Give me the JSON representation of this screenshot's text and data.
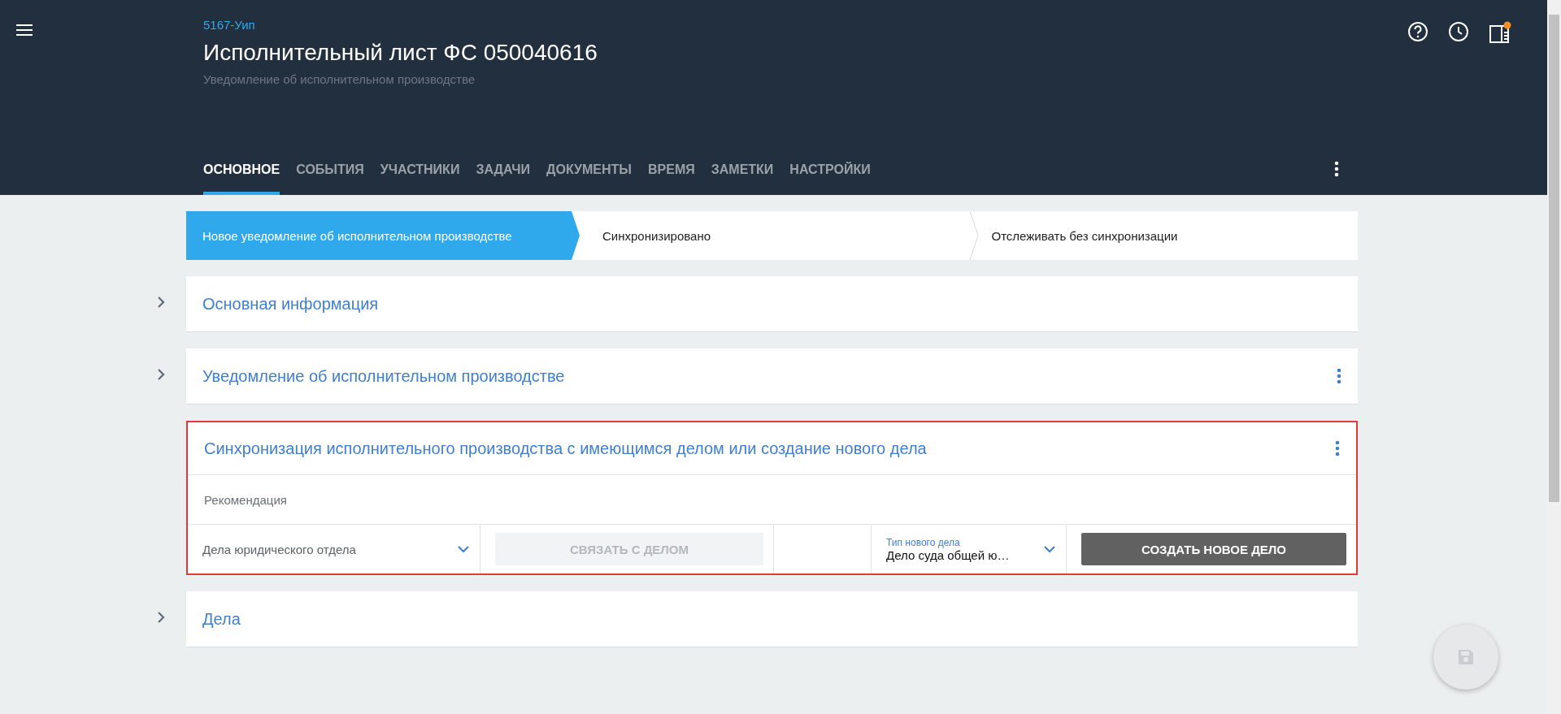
{
  "header": {
    "case_number": "5167-Уип",
    "title": "Исполнительный лист ФС 050040616",
    "subtitle": "Уведомление об исполнительном производстве",
    "panel_badge": true
  },
  "tabs": [
    {
      "label": "ОСНОВНОЕ",
      "selected": true
    },
    {
      "label": "СОБЫТИЯ",
      "selected": false
    },
    {
      "label": "УЧАСТНИКИ",
      "selected": false
    },
    {
      "label": "ЗАДАЧИ",
      "selected": false
    },
    {
      "label": "ДОКУМЕНТЫ",
      "selected": false
    },
    {
      "label": "ВРЕМЯ",
      "selected": false
    },
    {
      "label": "ЗАМЕТКИ",
      "selected": false
    },
    {
      "label": "НАСТРОЙКИ",
      "selected": false
    }
  ],
  "stepper": [
    {
      "label": "Новое уведомление об исполнительном производстве",
      "selected": true
    },
    {
      "label": "Синхронизировано",
      "selected": false
    },
    {
      "label": "Отслеживать без синхронизации",
      "selected": false
    }
  ],
  "sections": [
    {
      "title": "Основная информация",
      "expanded": false,
      "has_menu": false,
      "highlighted": false
    },
    {
      "title": "Уведомление об исполнительном производстве",
      "expanded": false,
      "has_menu": true,
      "highlighted": false
    },
    {
      "title": "Синхронизация исполнительного производства с имеющимся делом или создание нового дела",
      "expanded": true,
      "has_menu": true,
      "highlighted": true,
      "recommendation_label": "Рекомендация",
      "controls": [
        {
          "kind": "select",
          "value": "Дела юридического отдела"
        },
        {
          "kind": "button",
          "label": "СВЯЗАТЬ С ДЕЛОМ",
          "disabled": true
        },
        {
          "kind": "blank"
        },
        {
          "kind": "select",
          "label": "Тип нового дела",
          "value": "Дело суда общей ю…"
        },
        {
          "kind": "button",
          "label": "СОЗДАТЬ НОВОЕ ДЕЛО",
          "disabled": false
        }
      ]
    },
    {
      "title": "Дела",
      "expanded": false,
      "has_menu": false,
      "highlighted": false
    }
  ]
}
